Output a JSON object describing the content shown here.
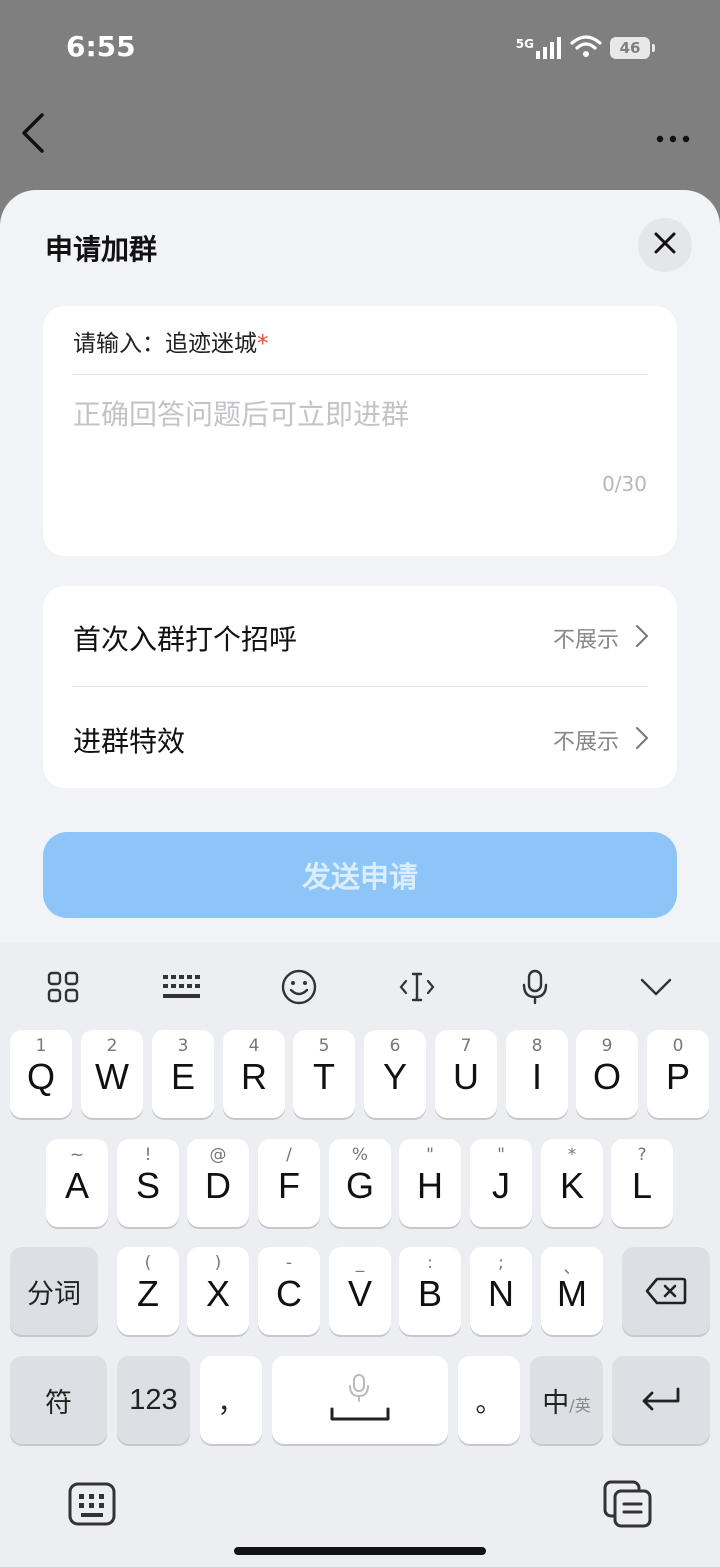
{
  "status_bar": {
    "time": "6:55",
    "network": "5G",
    "battery": "46"
  },
  "sheet": {
    "title": "申请加群",
    "question_prefix": "请输入：",
    "question": "追迹迷城",
    "required_mark": "*",
    "answer_placeholder": "正确回答问题后可立即进群",
    "answer_value": "",
    "char_counter": "0/30",
    "options": [
      {
        "label": "首次入群打个招呼",
        "value": "不展示"
      },
      {
        "label": "进群特效",
        "value": "不展示"
      }
    ],
    "send_button": "发送申请"
  },
  "keyboard": {
    "rows": [
      [
        {
          "main": "Q",
          "hint": "1"
        },
        {
          "main": "W",
          "hint": "2"
        },
        {
          "main": "E",
          "hint": "3"
        },
        {
          "main": "R",
          "hint": "4"
        },
        {
          "main": "T",
          "hint": "5"
        },
        {
          "main": "Y",
          "hint": "6"
        },
        {
          "main": "U",
          "hint": "7"
        },
        {
          "main": "I",
          "hint": "8"
        },
        {
          "main": "O",
          "hint": "9"
        },
        {
          "main": "P",
          "hint": "0"
        }
      ],
      [
        {
          "main": "A",
          "hint": "~"
        },
        {
          "main": "S",
          "hint": "!"
        },
        {
          "main": "D",
          "hint": "@"
        },
        {
          "main": "F",
          "hint": "/"
        },
        {
          "main": "G",
          "hint": "%"
        },
        {
          "main": "H",
          "hint": "\""
        },
        {
          "main": "J",
          "hint": "\""
        },
        {
          "main": "K",
          "hint": "*"
        },
        {
          "main": "L",
          "hint": "?"
        }
      ],
      [
        {
          "main": "Z",
          "hint": "("
        },
        {
          "main": "X",
          "hint": ")"
        },
        {
          "main": "C",
          "hint": "-"
        },
        {
          "main": "V",
          "hint": "_"
        },
        {
          "main": "B",
          "hint": ":"
        },
        {
          "main": "N",
          "hint": ";"
        },
        {
          "main": "M",
          "hint": "、"
        }
      ]
    ],
    "fenci": "分词",
    "fu": "符",
    "num": "123",
    "comma": "，",
    "period": "。",
    "lang_main": "中",
    "lang_sub": "/英"
  },
  "colors": {
    "accent_disabled": "#8ec5f8",
    "required": "#e5493b"
  }
}
